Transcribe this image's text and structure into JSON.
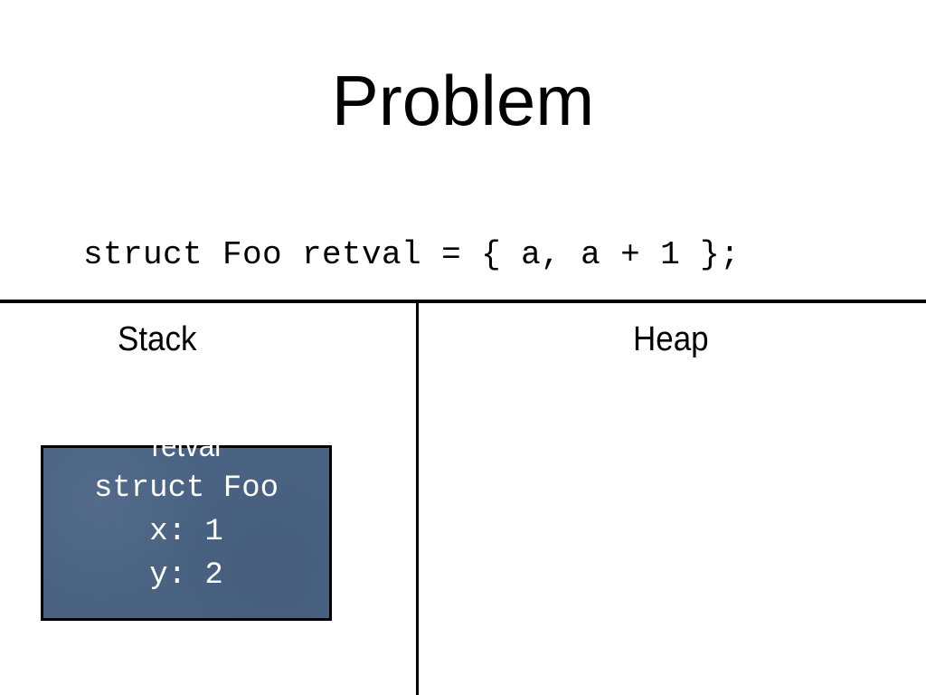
{
  "slide": {
    "title": "Problem",
    "code": "struct Foo retval = { a, a + 1 };",
    "columns": {
      "stack_label": "Stack",
      "heap_label": "Heap"
    },
    "stack_frame": {
      "name": "retval",
      "type": "struct Foo",
      "fields": [
        "x: 1",
        "y: 2"
      ],
      "fill_color": "#4a6383"
    }
  }
}
